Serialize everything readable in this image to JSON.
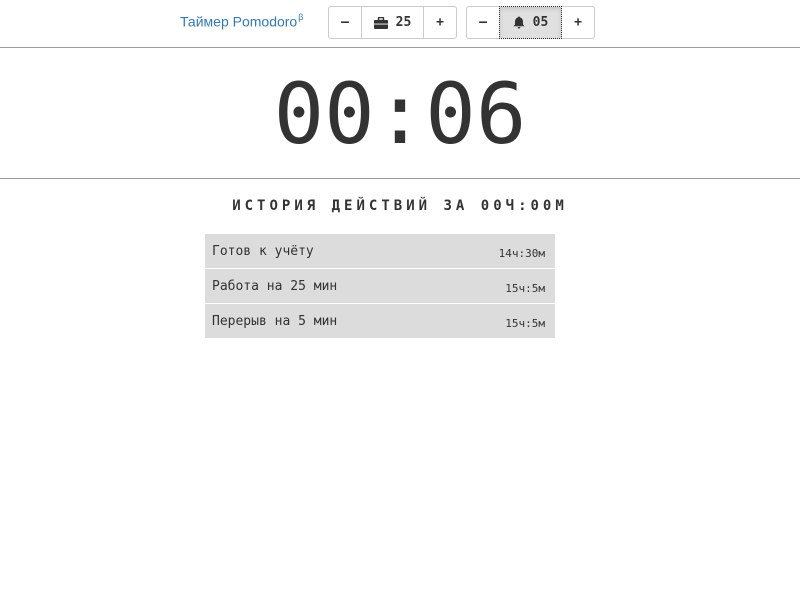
{
  "header": {
    "brand": "Таймер Pomodoro",
    "brand_sup": "β",
    "work_group": {
      "minus_label": "–",
      "icon": "briefcase-icon",
      "value": "25",
      "plus_label": "+"
    },
    "break_group": {
      "minus_label": "–",
      "icon": "bell-icon",
      "value": "05",
      "plus_label": "+"
    }
  },
  "timer": {
    "display": "00:06"
  },
  "history": {
    "title": "ИСТОРИЯ ДЕЙСТВИЙ ЗА 00Ч:00М",
    "items": [
      {
        "label": "Готов к учёту",
        "time": "14ч:30м"
      },
      {
        "label": "Работа на 25 мин",
        "time": "15ч:5м"
      },
      {
        "label": "Перерыв на 5 мин",
        "time": "15ч:5м"
      }
    ]
  }
}
